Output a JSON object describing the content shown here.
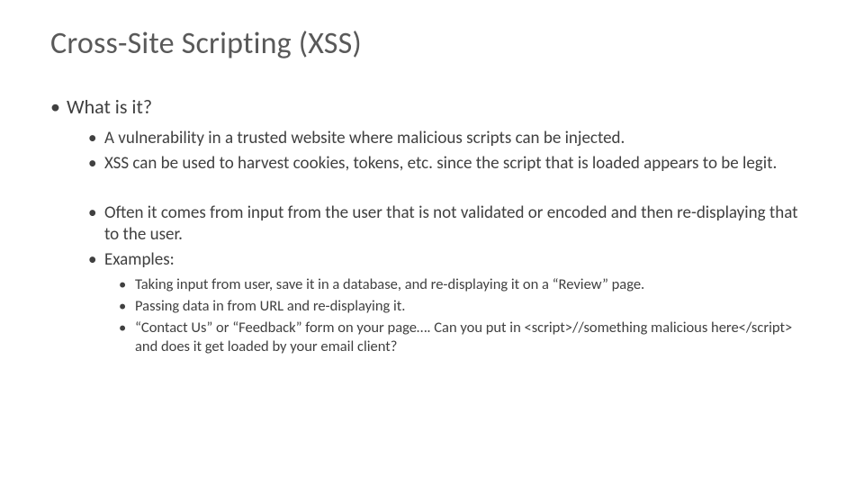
{
  "title": "Cross-Site Scripting (XSS)",
  "bullets": {
    "whatIsIt": "What is it?",
    "sub1": "A vulnerability in a trusted website where malicious scripts can be injected.",
    "sub2": "XSS can be used to harvest cookies, tokens, etc. since the script that is loaded appears to be legit.",
    "sub3": "Often it comes from input from the user that is not validated or encoded and then re-displaying that to the user.",
    "sub4": "Examples:",
    "ex1": "Taking input from user, save it in a database, and re-displaying it on a “Review” page.",
    "ex2": "Passing data in from URL and re-displaying it.",
    "ex3": "“Contact Us” or “Feedback” form on your page…. Can you put in <script>//something malicious here</script> and does it get loaded by your email client?"
  }
}
